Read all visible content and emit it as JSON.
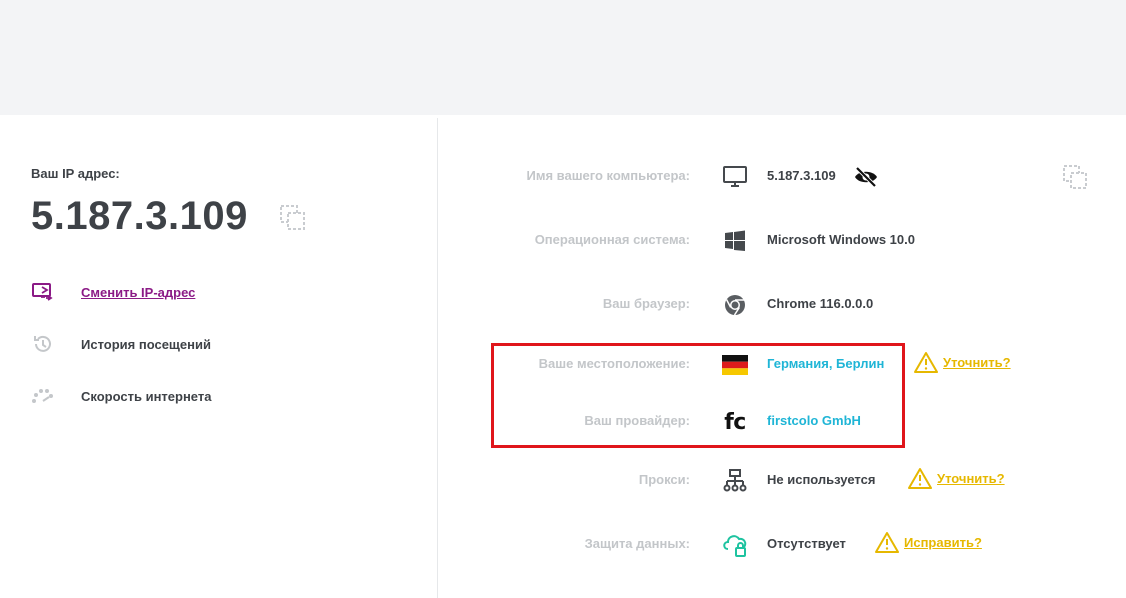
{
  "left": {
    "ip_label": "Ваш IP адрес:",
    "ip_value": "5.187.3.109",
    "nav": [
      {
        "label": "Сменить IP-адрес",
        "icon": "switch-ip-icon",
        "link": true,
        "color": "#8b1a86"
      },
      {
        "label": "История посещений",
        "icon": "history-icon",
        "link": false
      },
      {
        "label": "Скорость интернета",
        "icon": "speedometer-icon",
        "link": false
      }
    ]
  },
  "rows": {
    "computer": {
      "label": "Имя вашего компьютера:",
      "value": "5.187.3.109",
      "icon": "monitor-icon"
    },
    "os": {
      "label": "Операционная система:",
      "value": "Microsoft Windows 10.0",
      "icon": "windows-icon"
    },
    "browser": {
      "label": "Ваш браузер:",
      "value": "Chrome 116.0.0.0",
      "icon": "chrome-icon"
    },
    "location": {
      "label": "Ваше местоположение:",
      "value": "Германия, Берлин",
      "icon": "germany-flag-icon",
      "action": "Уточнить?"
    },
    "provider": {
      "label": "Ваш провайдер:",
      "value": "firstcolo GmbH",
      "logo": "fc"
    },
    "proxy": {
      "label": "Прокси:",
      "value": "Не используется",
      "icon": "network-icon",
      "action": "Уточнить?"
    },
    "protection": {
      "label": "Защита данных:",
      "value": "Отсутствует",
      "icon": "cloud-lock-icon",
      "action": "Исправить?"
    }
  },
  "colors": {
    "accent_link": "#8b1a86",
    "value_blue": "#1fb5d6",
    "warning": "#e6b800",
    "highlight_box": "#e0161b",
    "label_gray": "#c3c6c9"
  }
}
